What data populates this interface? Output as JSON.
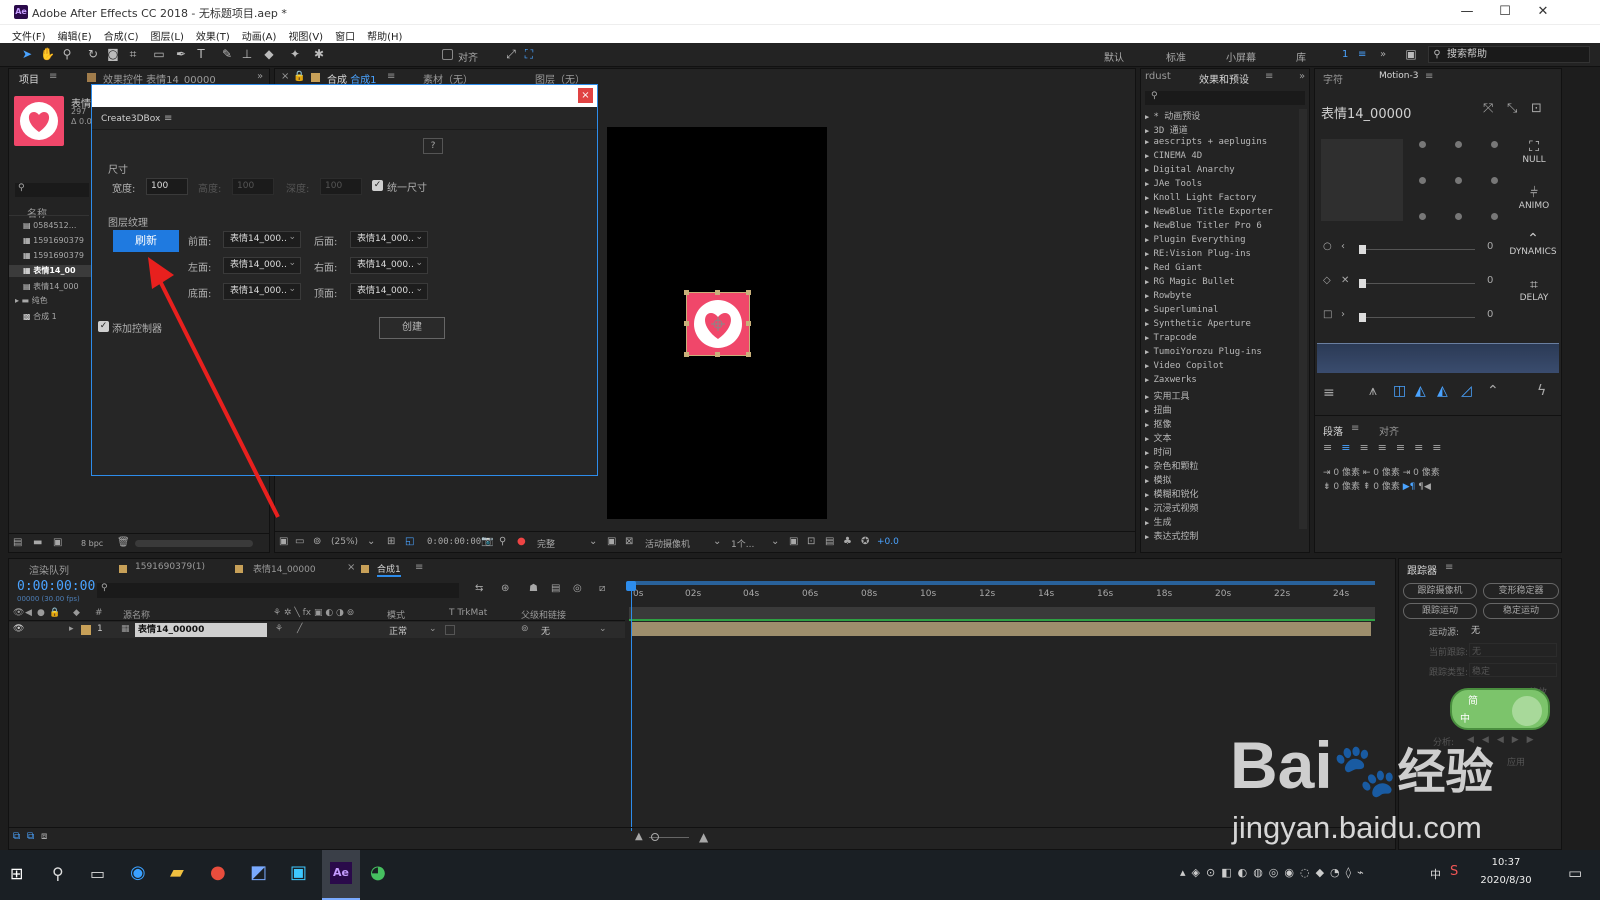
{
  "window": {
    "title": "Adobe After Effects CC 2018 - 无标题项目.aep *",
    "logo": "Ae",
    "minimize": "—",
    "maximize": "☐",
    "close": "✕"
  },
  "menu": [
    "文件(F)",
    "编辑(E)",
    "合成(C)",
    "图层(L)",
    "效果(T)",
    "动画(A)",
    "视图(V)",
    "窗口",
    "帮助(H)"
  ],
  "toolbar": {
    "align_label": "对齐",
    "workspaces": [
      "默认",
      "标准",
      "小屏幕",
      "库"
    ],
    "workspace_num": "1",
    "search_placeholder": "搜索帮助"
  },
  "project": {
    "tab_project": "项目",
    "tab_effects": "效果控件 表情14_00000",
    "thumb_name": "表情",
    "thumb_meta1": "297",
    "thumb_meta2": "Δ 0.0",
    "col_name": "名称",
    "items": [
      "0584512...",
      "1591690379",
      "1591690379",
      "表情14_00",
      "表情14_000",
      "纯色",
      "合成 1"
    ],
    "bpc": "8 bpc"
  },
  "viewer": {
    "tab_comp_prefix": "合成",
    "tab_comp_name": "合成1",
    "tab_footage": "素材（无）",
    "tab_layer": "图层（无）",
    "zoom": "(25%)",
    "timecode": "0:00:00:00",
    "quality": "完整",
    "camera": "活动摄像机",
    "views": "1个...",
    "exposure": "+0.0"
  },
  "dialog": {
    "panel_title": "Create3DBox",
    "help": "?",
    "section_size": "尺寸",
    "width_label": "宽度:",
    "width_value": "100",
    "height_label": "高度:",
    "height_value": "100",
    "depth_label": "深度:",
    "depth_value": "100",
    "uniform_label": "统一尺寸",
    "section_texture": "图层纹理",
    "refresh_button": "刷新",
    "front_label": "前面:",
    "back_label": "后面:",
    "left_label": "左面:",
    "right_label": "右面:",
    "bottom_label": "底面:",
    "top_label": "顶面:",
    "layer_value": "表情14_000..",
    "add_controller_label": "添加控制器",
    "create_button": "创建",
    "close": "×"
  },
  "effects": {
    "tab_rdust": "rdust",
    "tab_effects": "效果和预设",
    "items": [
      "* 动画预设",
      "3D 通道",
      "aescripts + aeplugins",
      "CINEMA 4D",
      "Digital Anarchy",
      "JAe Tools",
      "Knoll Light Factory",
      "NewBlue Title Exporter",
      "NewBlue Titler Pro 6",
      "Plugin Everything",
      "RE:Vision Plug-ins",
      "Red Giant",
      "RG Magic Bullet",
      "Rowbyte",
      "Superluminal",
      "Synthetic Aperture",
      "Trapcode",
      "TumoiYorozu Plug-ins",
      "Video Copilot",
      "Zaxwerks",
      "实用工具",
      "扭曲",
      "抠像",
      "文本",
      "时间",
      "杂色和颗粒",
      "模拟",
      "模糊和锐化",
      "沉浸式视频",
      "生成",
      "表达式控制"
    ]
  },
  "right": {
    "tab_char": "字符",
    "tab_motion": "Motion-3",
    "layer_name": "表情14_00000",
    "null_label": "NULL",
    "animo_label": "ANIMO",
    "dynamics_label": "DYNAMICS",
    "delay_label": "DELAY",
    "slider_values": [
      "0",
      "0",
      "0"
    ],
    "tab_paragraph": "段落",
    "tab_align": "对齐",
    "px_labels": [
      "0 像素",
      "0 像素",
      "0 像素",
      "0 像素",
      "0 像素"
    ]
  },
  "timeline": {
    "tab_render": "渲染队列",
    "tab_comp1": "1591690379(1)",
    "tab_comp2": "表情14_00000",
    "tab_comp3": "合成1",
    "timecode": "0:00:00:00",
    "timecode_sub": "00000 (30.00 fps)",
    "col_source": "源名称",
    "col_mode": "模式",
    "col_trkmat": "T  TrkMat",
    "col_parent": "父级和链接",
    "layer_index": "1",
    "layer_name": "表情14_00000",
    "layer_mode": "正常",
    "layer_parent": "无",
    "ruler": [
      "0s",
      "02s",
      "04s",
      "06s",
      "08s",
      "10s",
      "12s",
      "14s",
      "16s",
      "18s",
      "20s",
      "22s",
      "24s"
    ]
  },
  "tracker": {
    "title": "跟踪器",
    "btn_track_camera": "跟踪摄像机",
    "btn_warp": "变形稳定器",
    "btn_track_motion": "跟踪运动",
    "btn_stabilize": "稳定运动",
    "motion_source_label": "运动源:",
    "motion_source_value": "无",
    "current_track_label": "当前跟踪:",
    "current_track_value": "无",
    "track_type_label": "跟踪类型:",
    "track_type_value": "稳定",
    "scale_label": "缩放",
    "analyze_label": "分析:",
    "apply_label": "应用"
  },
  "ime": {
    "line1": "简",
    "line2": "中"
  },
  "watermark": {
    "brand": "Bai",
    "brand2": "经验",
    "url": "jingyan.baidu.com"
  },
  "taskbar": {
    "time": "10:37",
    "date": "2020/8/30",
    "lang": "中",
    "ae": "Ae"
  }
}
